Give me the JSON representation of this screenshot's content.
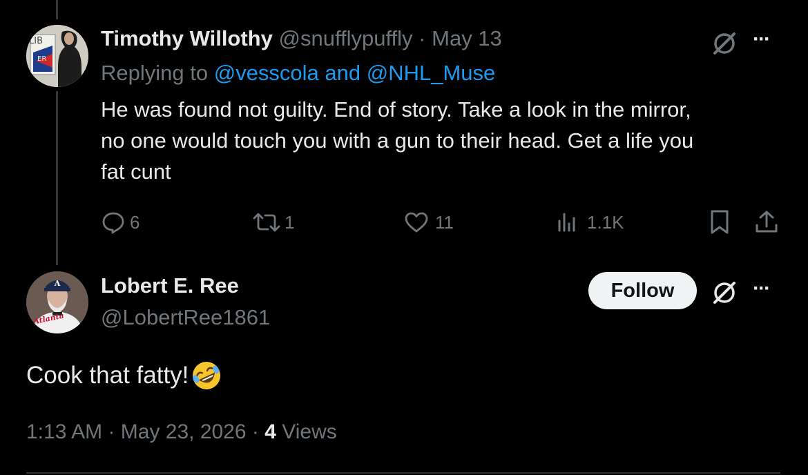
{
  "reply_tweet": {
    "display_name": "Timothy Willothy",
    "handle": "@snufflypuffly",
    "separator": "·",
    "date": "May 13",
    "replying_prefix": "Replying to",
    "replying_to": "@vesscola and @NHL_Muse",
    "text_line1": "He was found not guilty. End of story. Take a look in the mirror,",
    "text_line2": "no one would touch you with a gun to their head. Get a life you",
    "text_line3": "fat cunt",
    "replies": "6",
    "reposts": "1",
    "likes": "11",
    "views": "1.1K",
    "more_label": "···",
    "avatar_text_top": "LIB",
    "avatar_text_bottom": "ER"
  },
  "main_tweet": {
    "display_name": "Lobert E. Ree",
    "handle": "@LobertRee1861",
    "follow_label": "Follow",
    "text": "Cook that fatty!",
    "emoji": "🤣",
    "time": "1:13 AM",
    "separator": "·",
    "date": "May 23, 2026",
    "views_count": "4",
    "views_label": "Views",
    "more_label": "···",
    "jersey_text": "Atlanta"
  },
  "colors": {
    "background": "#000000",
    "text": "#e7e9ea",
    "muted": "#71767b",
    "link": "#1d9bf0",
    "button_bg": "#eff3f4"
  }
}
